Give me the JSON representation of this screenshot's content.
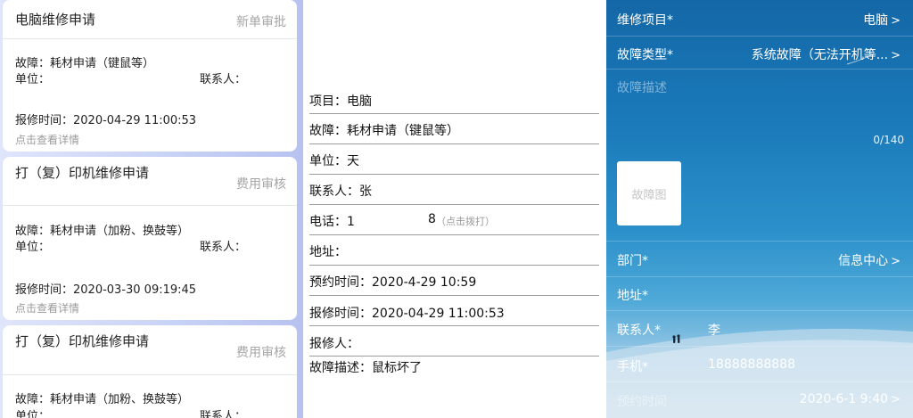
{
  "list": {
    "cards": [
      {
        "title": "电脑维修申请",
        "status": "新单审批",
        "fault": "故障：耗材申请（键鼠等）",
        "unit": "单位：",
        "contact": "联系人：",
        "time": "报修时间：2020-04-29 11:00:53",
        "detail": "点击查看详情"
      },
      {
        "title": "打（复）印机维修申请",
        "status": "费用审核",
        "fault": "故障：耗材申请（加粉、换鼓等）",
        "unit": "单位：",
        "contact": "联系人：",
        "time": "报修时间：2020-03-30 09:19:45",
        "detail": "点击查看详情"
      },
      {
        "title": "打（复）印机维修申请",
        "status": "费用审核",
        "fault": "故障：耗材申请（加粉、换鼓等）",
        "unit": "单位：",
        "contact": "联系人："
      }
    ]
  },
  "detail": {
    "project": "项目：电脑",
    "fault": "故障：耗材申请（键鼠等）",
    "unit": "单位：天",
    "contact": "联系人：张",
    "phone": "电话：1",
    "phone_tail": "8",
    "dial_hint": "（点击拨打）",
    "address": "地址：",
    "appointment": "预约时间：2020-4-29 10:59",
    "report_time": "报修时间：2020-04-29 11:00:53",
    "reporter": "报修人：",
    "description": "故障描述：鼠标坏了"
  },
  "form": {
    "project_label": "维修项目*",
    "project_value": "电脑",
    "fault_type_label": "故障类型*",
    "fault_type_value": "系统故障（无法开机等...",
    "desc_placeholder": "故障描述",
    "desc_counter": "0/140",
    "image_placeholder": "故障图",
    "dept_label": "部门*",
    "dept_value": "信息中心",
    "address_label": "地址*",
    "contact_label": "联系人*",
    "contact_value": "李",
    "phone_label": "手机*",
    "phone_value": "18888888888",
    "appointment_label": "预约时间",
    "appointment_value": "2020-6-1 9:40",
    "chevron": ">"
  },
  "colors": {
    "status_gray": "#a6a6a6",
    "form_sky_top": "#1467a6",
    "form_sky_bottom": "#c7ddea"
  }
}
